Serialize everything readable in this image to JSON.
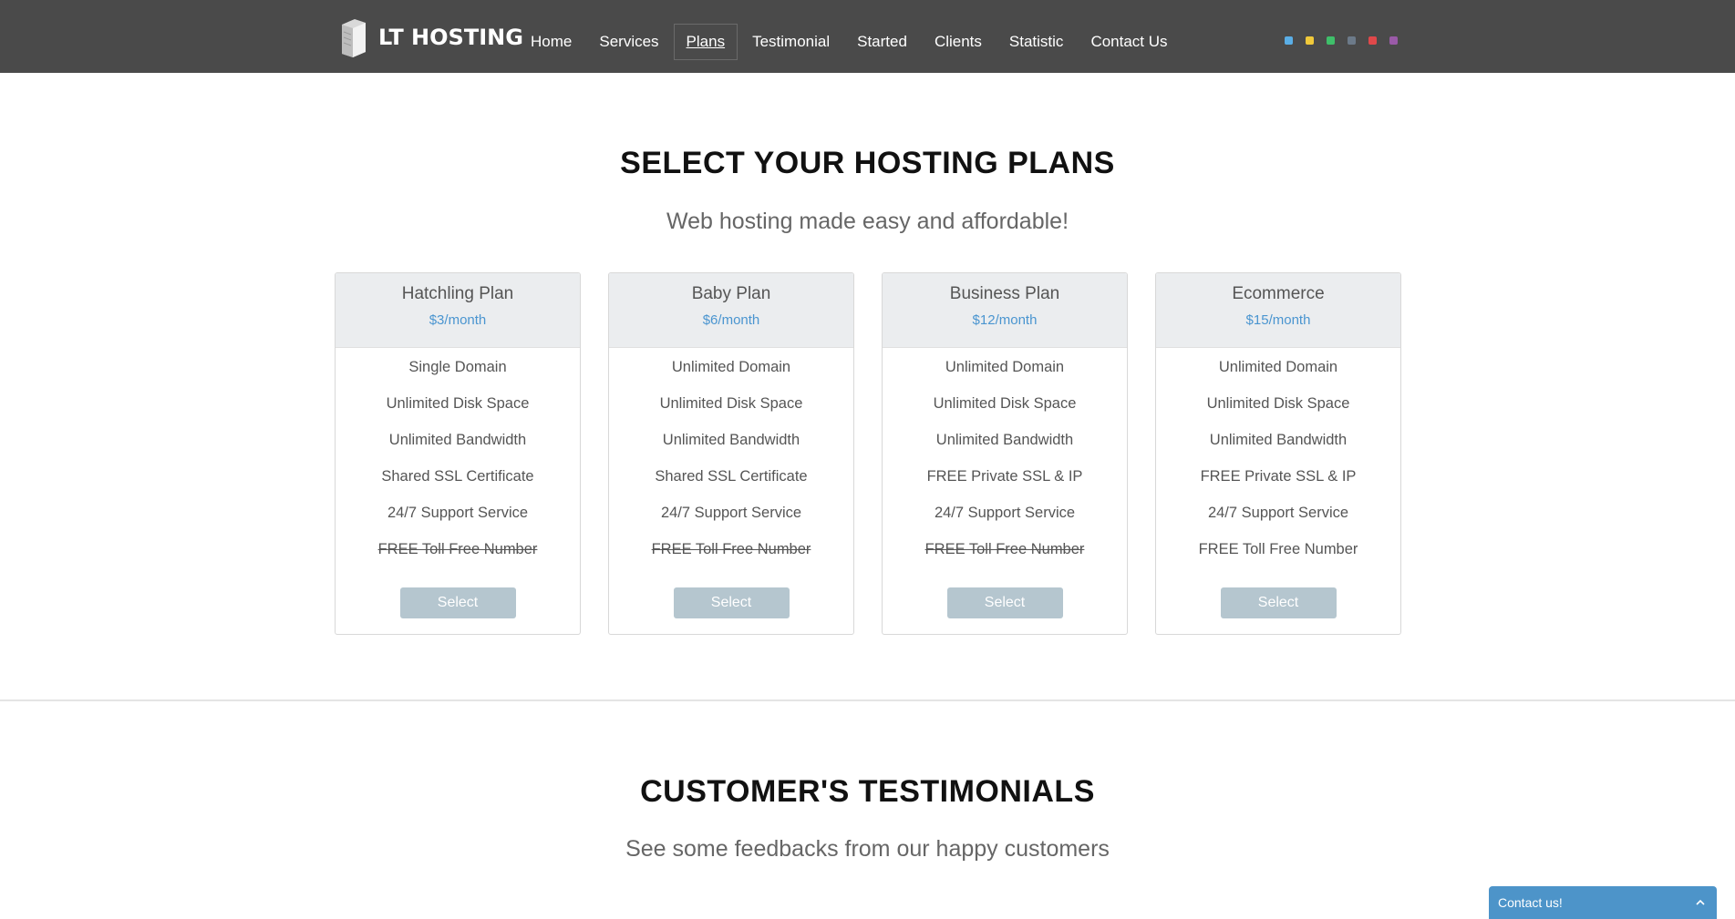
{
  "brand": {
    "name": "LT HOSTING"
  },
  "nav": {
    "items": [
      {
        "label": "Home"
      },
      {
        "label": "Services"
      },
      {
        "label": "Plans",
        "active": true
      },
      {
        "label": "Testimonial"
      },
      {
        "label": "Started"
      },
      {
        "label": "Clients"
      },
      {
        "label": "Statistic"
      },
      {
        "label": "Contact Us"
      }
    ]
  },
  "theme_swatches": [
    "#5aaee6",
    "#f0c93a",
    "#3fbf6a",
    "#6c7a89",
    "#e0484a",
    "#9a5aa8"
  ],
  "plans_section": {
    "title": "SELECT YOUR HOSTING PLANS",
    "subtitle": "Web hosting made easy and affordable!",
    "plans": [
      {
        "name": "Hatchling Plan",
        "price": "$3/month",
        "features": [
          {
            "text": "Single Domain",
            "included": true
          },
          {
            "text": "Unlimited Disk Space",
            "included": true
          },
          {
            "text": "Unlimited Bandwidth",
            "included": true
          },
          {
            "text": "Shared SSL Certificate",
            "included": true
          },
          {
            "text": "24/7 Support Service",
            "included": true
          },
          {
            "text": "FREE Toll Free Number",
            "included": false
          }
        ],
        "button": "Select"
      },
      {
        "name": "Baby Plan",
        "price": "$6/month",
        "features": [
          {
            "text": "Unlimited Domain",
            "included": true
          },
          {
            "text": "Unlimited Disk Space",
            "included": true
          },
          {
            "text": "Unlimited Bandwidth",
            "included": true
          },
          {
            "text": "Shared SSL Certificate",
            "included": true
          },
          {
            "text": "24/7 Support Service",
            "included": true
          },
          {
            "text": "FREE Toll Free Number",
            "included": false
          }
        ],
        "button": "Select"
      },
      {
        "name": "Business Plan",
        "price": "$12/month",
        "features": [
          {
            "text": "Unlimited Domain",
            "included": true
          },
          {
            "text": "Unlimited Disk Space",
            "included": true
          },
          {
            "text": "Unlimited Bandwidth",
            "included": true
          },
          {
            "text": "FREE Private SSL & IP",
            "included": true
          },
          {
            "text": "24/7 Support Service",
            "included": true
          },
          {
            "text": "FREE Toll Free Number",
            "included": false
          }
        ],
        "button": "Select"
      },
      {
        "name": "Ecommerce",
        "price": "$15/month",
        "features": [
          {
            "text": "Unlimited Domain",
            "included": true
          },
          {
            "text": "Unlimited Disk Space",
            "included": true
          },
          {
            "text": "Unlimited Bandwidth",
            "included": true
          },
          {
            "text": "FREE Private SSL & IP",
            "included": true
          },
          {
            "text": "24/7 Support Service",
            "included": true
          },
          {
            "text": "FREE Toll Free Number",
            "included": true
          }
        ],
        "button": "Select"
      }
    ]
  },
  "testimonials_section": {
    "title": "CUSTOMER'S TESTIMONIALS",
    "subtitle": "See some feedbacks from our happy customers"
  },
  "contact_widget": {
    "label": "Contact us!"
  }
}
